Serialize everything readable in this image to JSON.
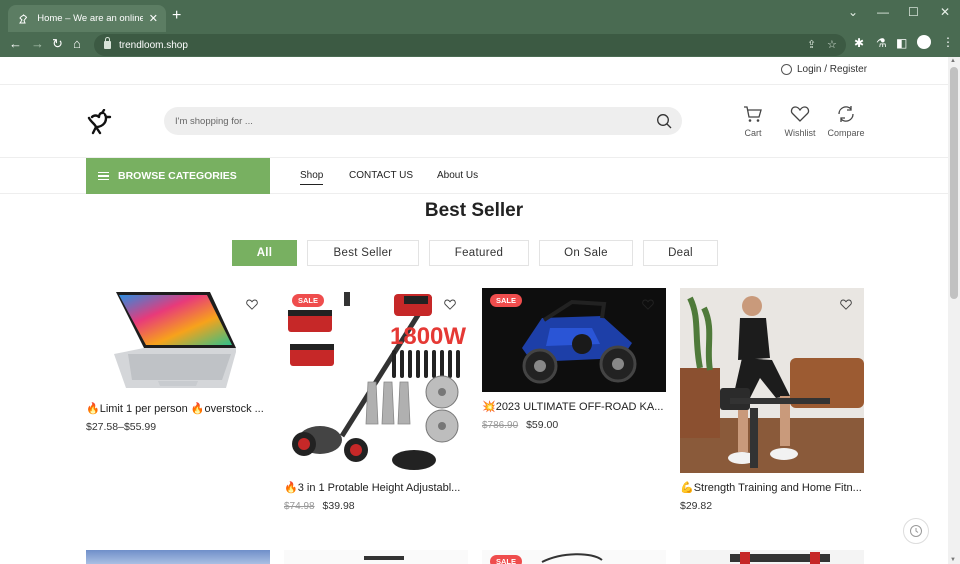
{
  "browser": {
    "tab_title": "Home – We are an online retail s",
    "tab_close": "✕",
    "new_tab": "+",
    "url": "trendloom.shop",
    "window_controls": [
      "⌄",
      "—",
      "☐",
      "✕"
    ],
    "nav": {
      "back": "←",
      "forward": "→",
      "reload": "↻",
      "home": "⌂"
    },
    "toolbar_icons": [
      "share-icon",
      "star-icon",
      "extensions-icon",
      "labs-icon",
      "sidepanel-icon",
      "profile-icon",
      "menu-icon"
    ]
  },
  "topbar": {
    "login": "Login / Register"
  },
  "header": {
    "search_placeholder": "I'm shopping for ...",
    "icons": [
      {
        "label": "Cart",
        "icon": "cart-icon"
      },
      {
        "label": "Wishlist",
        "icon": "heart-icon"
      },
      {
        "label": "Compare",
        "icon": "refresh-icon"
      }
    ]
  },
  "nav": {
    "browse": "BROWSE CATEGORIES",
    "links": [
      "Shop",
      "CONTACT US",
      "About Us"
    ]
  },
  "section": {
    "title": "Best Seller",
    "filters": [
      "All",
      "Best Seller",
      "Featured",
      "On Sale",
      "Deal"
    ],
    "active_filter": "All"
  },
  "products": [
    {
      "title": "🔥Limit 1 per person 🔥overstock ...",
      "price": "$27.58–$55.99",
      "old_price": "",
      "sale": ""
    },
    {
      "title": "🔥3 in 1 Protable Height Adjustabl...",
      "price": "$39.98",
      "old_price": "$74.98",
      "sale": "SALE"
    },
    {
      "title": "💥2023 ULTIMATE OFF-ROAD KA...",
      "price": "$59.00",
      "old_price": "$786.90",
      "sale": "SALE"
    },
    {
      "title": "💪Strength Training and Home Fitn...",
      "price": "$29.82",
      "old_price": "",
      "sale": ""
    }
  ],
  "trimmer_label": "1800W",
  "colors": {
    "accent": "#78b061",
    "sale": "#ef4d4d",
    "chrome": "#4a6b52"
  }
}
